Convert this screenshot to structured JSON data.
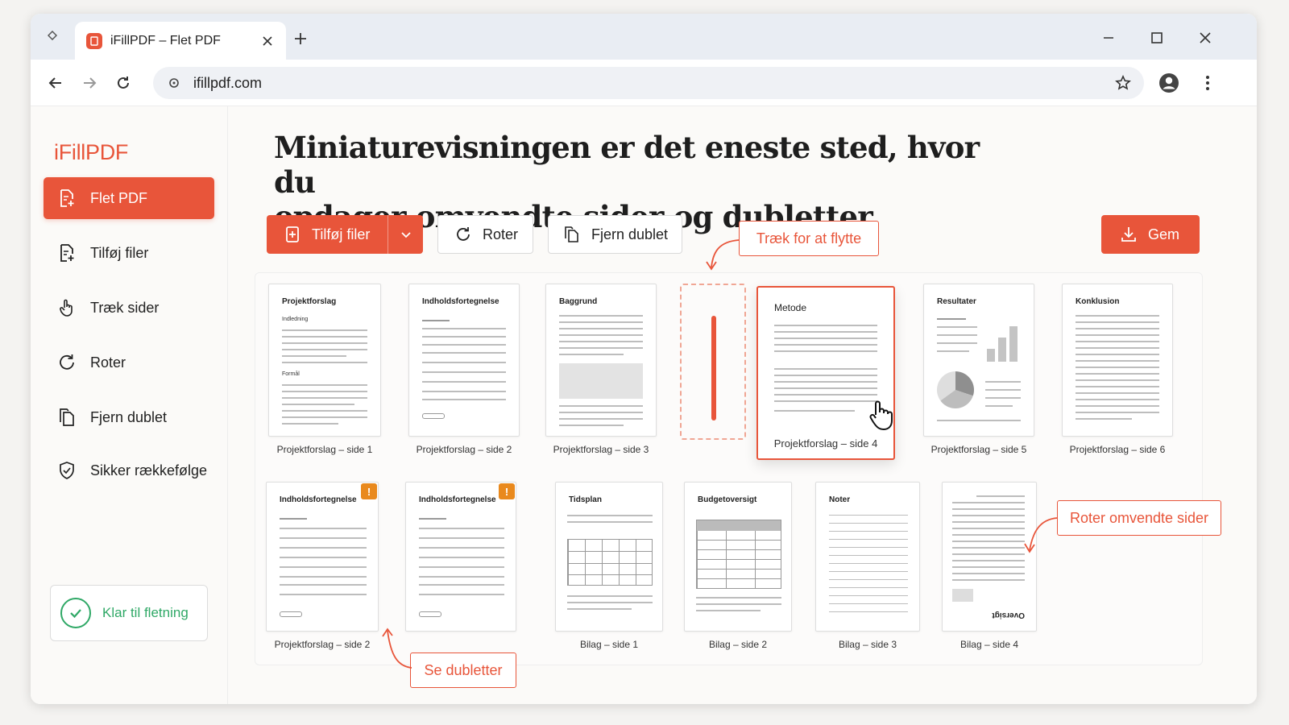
{
  "browser": {
    "tab_title": "iFillPDF – Flet PDF",
    "url": "ifillpdf.com"
  },
  "sidebar": {
    "logo": "iFillPDF",
    "items": [
      {
        "label": "Flet PDF",
        "icon": "merge-pdf-icon",
        "active": true
      },
      {
        "label": "Tilføj filer",
        "icon": "add-file-icon",
        "active": false
      },
      {
        "label": "Træk sider",
        "icon": "hand-drag-icon",
        "active": false
      },
      {
        "label": "Roter",
        "icon": "rotate-icon",
        "active": false
      },
      {
        "label": "Fjern dublet",
        "icon": "duplicate-icon",
        "active": false
      },
      {
        "label": "Sikker rækkefølge",
        "icon": "shield-check-icon",
        "active": false
      }
    ],
    "status": "Klar til fletning"
  },
  "main": {
    "headline_line1": "Miniaturevisningen er det eneste sted, hvor du",
    "headline_line2": "opdager omvendte sider og dubletter",
    "toolbar": {
      "add_files": "Tilføj filer",
      "rotate": "Roter",
      "remove_duplicate": "Fjern dublet",
      "save": "Gem"
    },
    "callouts": {
      "drag": "Træk for at flytte",
      "duplicates": "Se dubletter",
      "rotate": "Roter omvendte sider"
    },
    "row1": [
      {
        "title": "Projektforslag",
        "sub1": "Indledning",
        "sub2": "Formål",
        "caption": "Projektforslag – side 1"
      },
      {
        "title": "Indholdsfortegnelse",
        "caption": "Projektforslag – side 2"
      },
      {
        "title": "Baggrund",
        "caption": "Projektforslag – side 3"
      },
      {
        "title": "Metode",
        "caption": "Projektforslag – side 4"
      },
      {
        "title": "Resultater",
        "caption": "Projektforslag – side 5"
      },
      {
        "title": "Konklusion",
        "caption": "Projektforslag – side 6"
      }
    ],
    "row2": [
      {
        "title": "Indholdsfortegnelse",
        "caption": "Projektforslag – side 2",
        "warning": "!"
      },
      {
        "title": "Indholdsfortegnelse",
        "caption": "",
        "warning": "!"
      },
      {
        "title": "Tidsplan",
        "caption": "Bilag – side 1"
      },
      {
        "title": "Budgetoversigt",
        "caption": "Bilag – side 2"
      },
      {
        "title": "Noter",
        "caption": "Bilag – side 3"
      },
      {
        "title": "Oversigt",
        "caption": "Bilag – side 4"
      }
    ]
  },
  "colors": {
    "accent": "#e8553a",
    "success": "#2fa866",
    "warning": "#e9891d"
  }
}
